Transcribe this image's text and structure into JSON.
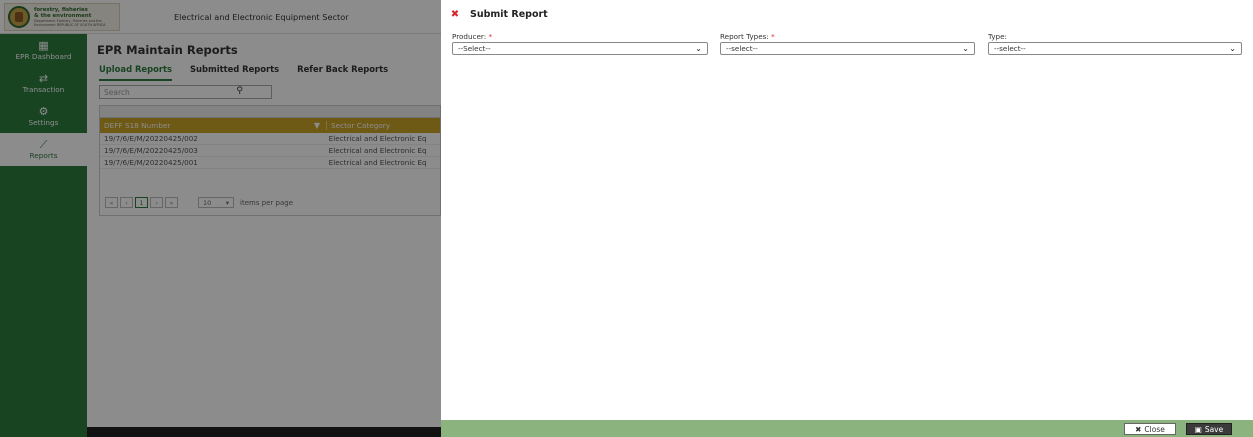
{
  "app": {
    "logo": {
      "line1": "forestry, fisheries",
      "line2": "& the environment",
      "sub": "Department: Forestry, Fisheries and the Environment REPUBLIC OF SOUTH AFRICA"
    },
    "sector_title": "Electrical and Electronic Equipment Sector",
    "sidebar": {
      "items": [
        {
          "icon": "dashboard-icon",
          "glyph": "▦",
          "label": "EPR Dashboard"
        },
        {
          "icon": "transaction-icon",
          "glyph": "⇄",
          "label": "Transaction"
        },
        {
          "icon": "settings-icon",
          "glyph": "⚙",
          "label": "Settings"
        },
        {
          "icon": "reports-icon",
          "glyph": "⟋",
          "label": "Reports"
        }
      ]
    },
    "page_title": "EPR Maintain Reports",
    "tabs": [
      {
        "label": "Upload Reports"
      },
      {
        "label": "Submitted Reports"
      },
      {
        "label": "Refer Back Reports"
      }
    ],
    "search": {
      "placeholder": "Search"
    },
    "grid": {
      "columns": [
        "DEFF S18 Number",
        "Sector Category"
      ],
      "rows": [
        [
          "19/7/6/E/M/20220425/002",
          "Electrical and Electronic Eq"
        ],
        [
          "19/7/6/E/M/20220425/003",
          "Electrical and Electronic Eq"
        ],
        [
          "19/7/6/E/M/20220425/001",
          "Electrical and Electronic Eq"
        ]
      ],
      "pager": {
        "first": "«",
        "prev": "‹",
        "current_page": "1",
        "next": "›",
        "last": "»",
        "page_size": "10",
        "items_per_page_label": "items per page"
      }
    }
  },
  "modal": {
    "title": "Submit Report",
    "close_icon_glyph": "✖",
    "fields": [
      {
        "label": "Producer:",
        "required": "*",
        "value": "--Select--"
      },
      {
        "label": "Report Types:",
        "required": "*",
        "value": "--select--"
      },
      {
        "label": "Type:",
        "required": "",
        "value": "--select--"
      }
    ],
    "buttons": {
      "close_label": "Close",
      "save_label": "Save"
    }
  },
  "colors": {
    "sidebar_green": "#2c7d3f",
    "grid_header_gold": "#c9a227",
    "modal_footer_green": "#8ab37d",
    "required_red": "#d9262c"
  }
}
